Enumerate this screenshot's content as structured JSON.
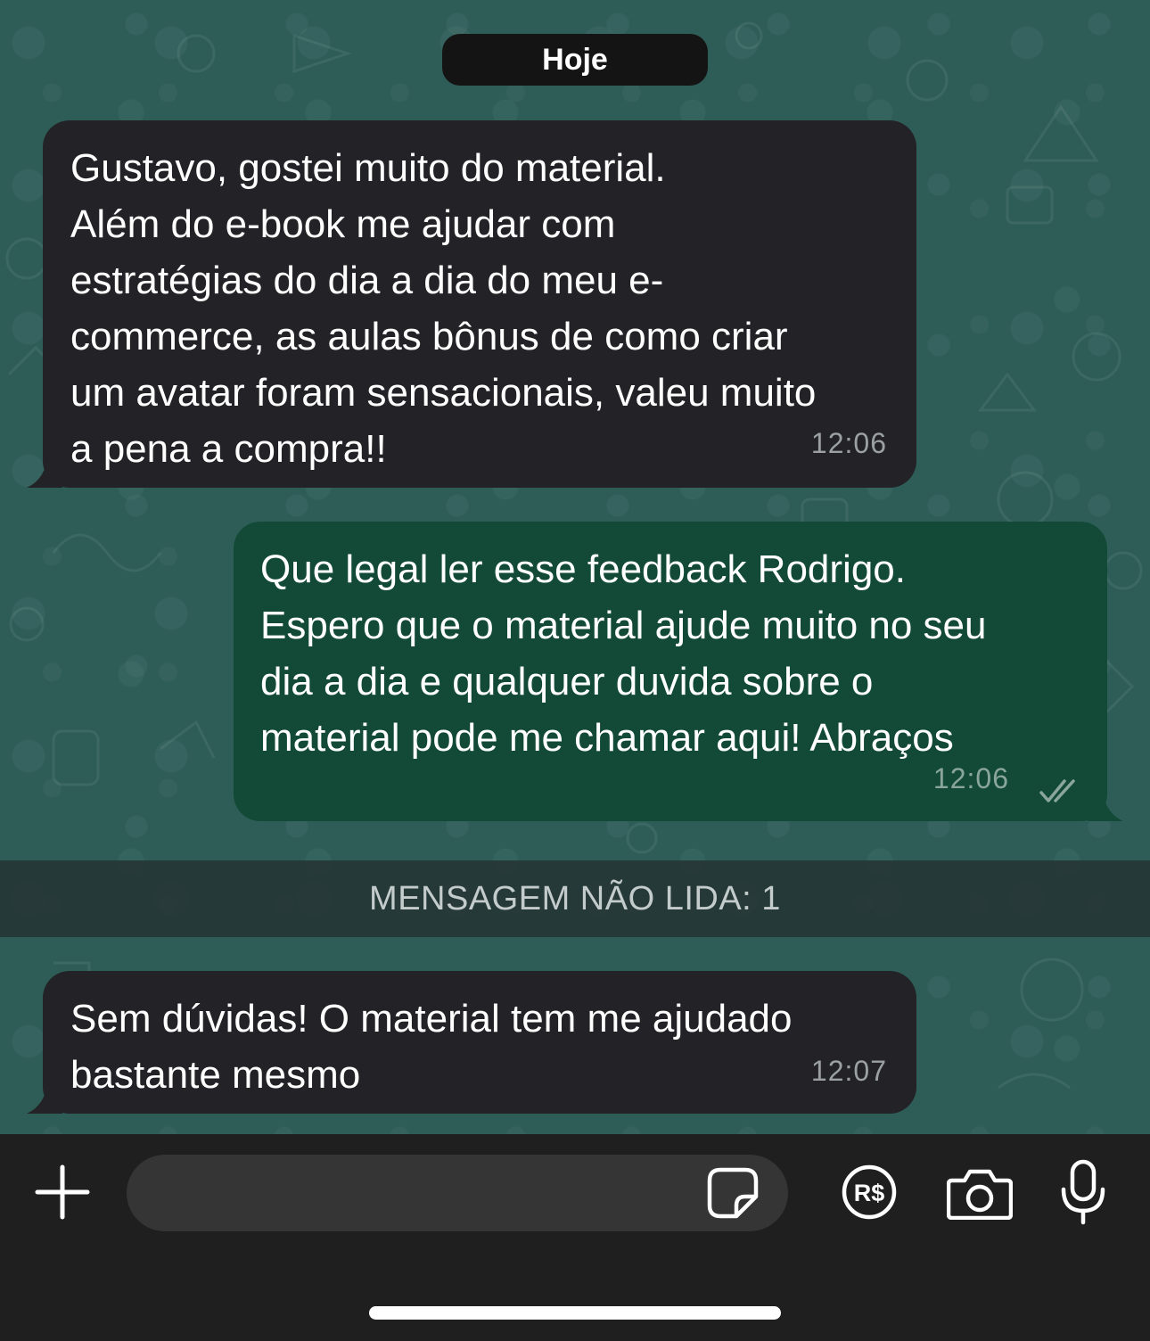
{
  "chat": {
    "date_label": "Hoje",
    "messages": [
      {
        "direction": "incoming",
        "text": "Gustavo, gostei muito do material.\nAlém do e-book me ajudar com\nestratégias do dia a dia do meu e-\ncommerce, as aulas bônus de como criar\num avatar foram sensacionais, valeu muito\na pena a compra!!",
        "time": "12:06"
      },
      {
        "direction": "outgoing",
        "text": "Que legal ler esse feedback Rodrigo.\nEspero que o material ajude muito no seu\ndia a dia e qualquer duvida sobre o\nmaterial pode me chamar aqui! Abraços",
        "time": "12:06",
        "status": "read"
      },
      {
        "direction": "incoming",
        "text": "Sem dúvidas! O material tem me ajudado\nbastante mesmo",
        "time": "12:07"
      }
    ],
    "unread_label": "MENSAGEM NÃO LIDA: 1"
  },
  "composer": {
    "value": "",
    "placeholder": "",
    "icons": [
      "plus-icon",
      "sticker-icon",
      "payment-real-icon",
      "camera-icon",
      "microphone-icon"
    ]
  },
  "colors": {
    "wallpaper": "#2e5d58",
    "incoming_bubble": "#232327",
    "outgoing_bubble": "#134a37",
    "input_bar": "#1f1f1f",
    "read_ticks": "#8aa59b"
  }
}
